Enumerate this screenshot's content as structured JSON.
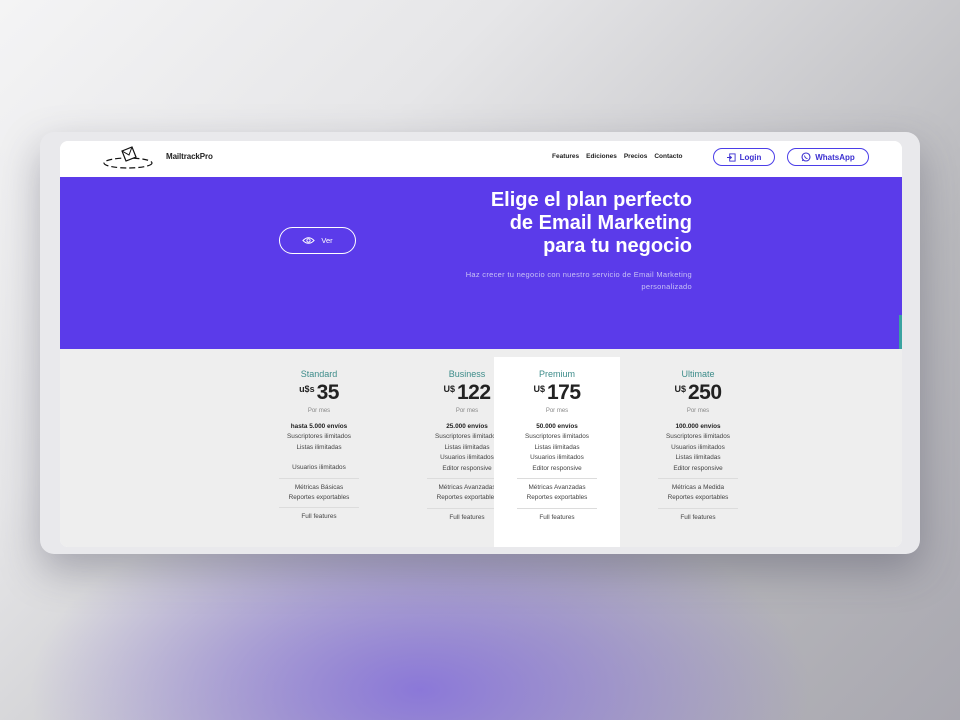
{
  "brand": {
    "name": "MailtrackPro"
  },
  "nav": {
    "items": [
      "Features",
      "Ediciones",
      "Precios",
      "Contacto"
    ],
    "login_label": "Login",
    "whatsapp_label": "WhatsApp"
  },
  "hero": {
    "title_line1": "Elige el plan perfecto",
    "title_line2": "de Email Marketing",
    "title_line3": "para tu negocio",
    "subtitle_line1": "Haz crecer tu negocio con nuestro servicio de Email Marketing",
    "subtitle_line2": "personalizado",
    "view_button": "Ver"
  },
  "plans": [
    {
      "name": "Standard",
      "currency": "u$s",
      "price": "35",
      "period": "Por mes",
      "sends": "hasta 5.000 envíos",
      "subs": "Suscriptores ilimitados",
      "lists": "Listas ilimitadas",
      "users": "Usuarios ilimitados",
      "editor": "",
      "metrics": "Métricas Básicas",
      "reports": "Reportes exportables",
      "full": "Full features"
    },
    {
      "name": "Business",
      "currency": "U$",
      "price": "122",
      "period": "Por mes",
      "sends": "25.000 envíos",
      "subs": "Suscriptores ilimitados",
      "lists": "Listas ilimitadas",
      "users": "Usuarios ilimitados",
      "editor": "Editor responsive",
      "metrics": "Métricas Avanzadas",
      "reports": "Reportes exportables",
      "full": "Full features"
    },
    {
      "name": "Premium",
      "currency": "U$",
      "price": "175",
      "period": "Por mes",
      "sends": "50.000 envíos",
      "subs": "Suscriptores ilimitados",
      "lists": "Listas ilimitadas",
      "users": "Usuarios ilimitados",
      "editor": "Editor responsive",
      "metrics": "Métricas Avanzadas",
      "reports": "Reportes exportables",
      "full": "Full features"
    },
    {
      "name": "Ultimate",
      "currency": "U$",
      "price": "250",
      "period": "Por mes",
      "sends": "100.000 envíos",
      "subs": "Suscriptores ilimitados",
      "lists": "Usuarios ilimitados",
      "users": "Listas ilimitadas",
      "editor": "Editor responsive",
      "metrics": "Métricas a Medida",
      "reports": "Reportes exportables",
      "full": "Full features"
    }
  ],
  "colors": {
    "primary": "#5b3bea",
    "accent": "#3d8c8a",
    "button_border": "#4b3ee8"
  },
  "icons": {
    "logo": "envelope-logo-icon",
    "login": "login-icon",
    "whatsapp": "whatsapp-icon",
    "view": "eye-icon"
  }
}
